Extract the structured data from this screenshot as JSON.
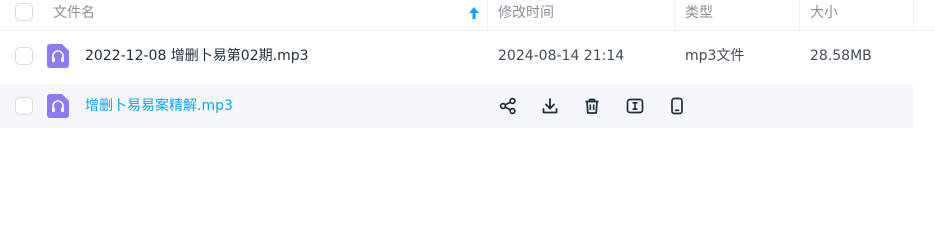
{
  "header": {
    "name_label": "文件名",
    "modified_label": "修改时间",
    "type_label": "类型",
    "size_label": "大小"
  },
  "files": [
    {
      "name": "2022-12-08 增删卜易第02期.mp3",
      "modified": "2024-08-14 21:14",
      "type": "mp3文件",
      "size": "28.58MB",
      "icon": "audio-file-icon"
    },
    {
      "name": "增删卜易易案精解.mp3",
      "icon": "audio-file-icon",
      "actions": [
        "share-icon",
        "download-icon",
        "delete-icon",
        "rename-icon",
        "send-to-phone-icon"
      ]
    }
  ],
  "colors": {
    "accent": "#06a7ff",
    "icon_purple": "#8c7bf7",
    "hover_row_bg": "#f6f7fa"
  }
}
